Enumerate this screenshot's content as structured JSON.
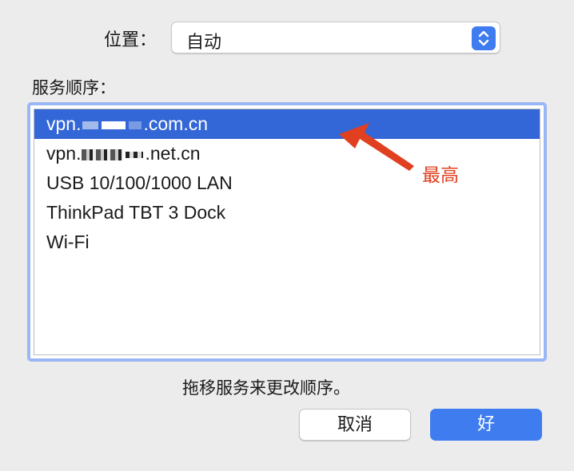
{
  "location": {
    "label": "位置：",
    "selected_value": "自动",
    "stepper_icon": "up-down-chevron-icon"
  },
  "services": {
    "label": "服务顺序：",
    "items": [
      {
        "prefix": "vpn.",
        "suffix": ".com.cn",
        "selected": true
      },
      {
        "prefix": "vpn.",
        "suffix": ".net.cn",
        "selected": false
      },
      {
        "prefix": "USB 10/100/1000 LAN",
        "suffix": "",
        "selected": false
      },
      {
        "prefix": "ThinkPad TBT 3 Dock",
        "suffix": "",
        "selected": false
      },
      {
        "prefix": "Wi-Fi",
        "suffix": "",
        "selected": false
      }
    ]
  },
  "annotation": {
    "text": "最高",
    "color": "#e04020"
  },
  "hint": "拖移服务来更改顺序。",
  "buttons": {
    "cancel": "取消",
    "ok": "好"
  },
  "colors": {
    "accent": "#3e7cf0",
    "selection": "#3366d6",
    "focus_ring": "#9bb6f5"
  }
}
